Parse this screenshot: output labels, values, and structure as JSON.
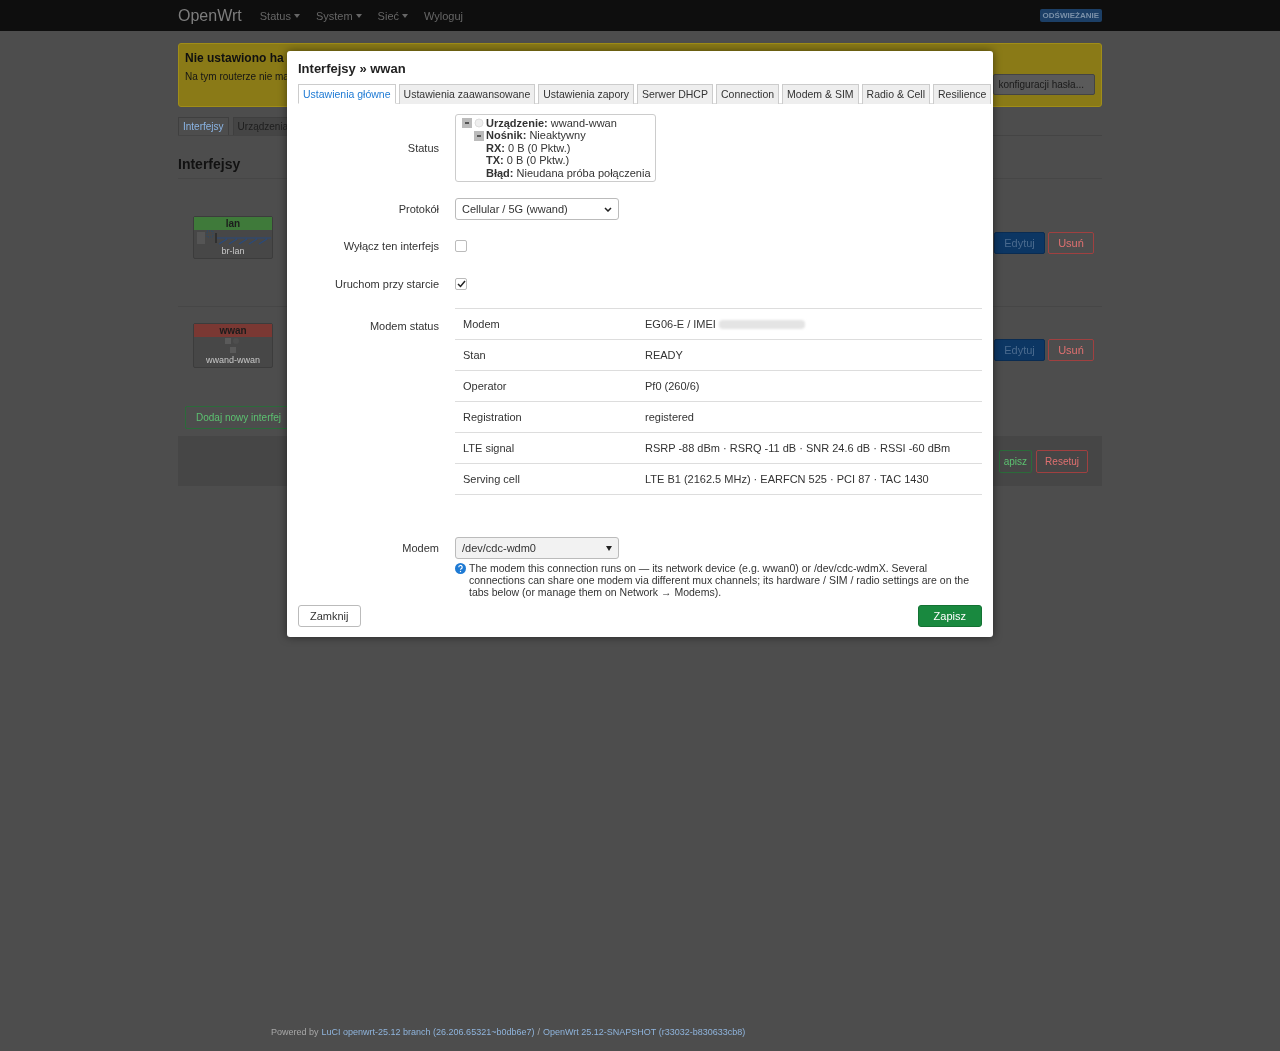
{
  "navbar": {
    "brand": "OpenWrt",
    "menu": [
      {
        "label": "Status",
        "has_caret": true
      },
      {
        "label": "System",
        "has_caret": true
      },
      {
        "label": "Sieć",
        "has_caret": true
      },
      {
        "label": "Wyloguj",
        "has_caret": false
      }
    ],
    "badge": "ODŚWIEŻANIE"
  },
  "warning": {
    "title": "Nie ustawiono ha",
    "text": "Na tym routerze nie ma",
    "button": "konfiguracji hasła..."
  },
  "page_tabs": [
    {
      "label": "Interfejsy",
      "selected": true
    },
    {
      "label": "Urządzenia",
      "selected": false
    }
  ],
  "heading": "Interfejsy",
  "interfaces": [
    {
      "name": "lan",
      "color": "#3f7a3a",
      "device": "br-lan",
      "kind": "bridge",
      "edit": "Edytuj",
      "delete": "Usuń"
    },
    {
      "name": "wwan",
      "color": "#7a3833",
      "device": "wwand-wwan",
      "kind": "modem",
      "edit": "Edytuj",
      "delete": "Usuń"
    }
  ],
  "add_button": "Dodaj nowy interfej",
  "actions": [
    {
      "label": "apisz",
      "kind": "save"
    },
    {
      "label": "Resetuj",
      "kind": "reset"
    }
  ],
  "footer": {
    "prefix": "Powered by",
    "luci": "LuCI openwrt-25.12 branch (26.206.65321~b0db6e7)",
    "separator": "/",
    "openwrt": "OpenWrt 25.12-SNAPSHOT (r33032-b830633cb8)"
  },
  "modal": {
    "title": "Interfejsy » wwan",
    "tabs": [
      {
        "label": "Ustawienia główne",
        "selected": true
      },
      {
        "label": "Ustawienia zaawansowane",
        "selected": false
      },
      {
        "label": "Ustawienia zapory",
        "selected": false
      },
      {
        "label": "Serwer DHCP",
        "selected": false
      },
      {
        "label": "Connection",
        "selected": false
      },
      {
        "label": "Modem & SIM",
        "selected": false
      },
      {
        "label": "Radio & Cell",
        "selected": false
      },
      {
        "label": "Resilience",
        "selected": false
      }
    ],
    "status": {
      "label": "Status",
      "lines": [
        {
          "key": "Urządzenie:",
          "value": "wwand-wwan"
        },
        {
          "key": "Nośnik:",
          "value": "Nieaktywny"
        },
        {
          "key": "RX:",
          "value": "0 B (0 Pktw.)"
        },
        {
          "key": "TX:",
          "value": "0 B (0 Pktw.)"
        },
        {
          "key": "Błąd:",
          "value": "Nieudana próba połączenia"
        }
      ]
    },
    "protocol": {
      "label": "Protokół",
      "value": "Cellular / 5G (wwand)"
    },
    "disable": {
      "label": "Wyłącz ten interfejs",
      "checked": false
    },
    "autostart": {
      "label": "Uruchom przy starcie",
      "checked": true
    },
    "modem_status": {
      "label": "Modem status",
      "rows": [
        {
          "name": "Modem",
          "value": "EG06-E / IMEI",
          "redacted": true
        },
        {
          "name": "Stan",
          "value": "READY",
          "redacted": false
        },
        {
          "name": "Operator",
          "value": "Pf0 (260/6)",
          "redacted": false
        },
        {
          "name": "Registration",
          "value": "registered",
          "redacted": false
        },
        {
          "name": "LTE signal",
          "value": "RSRP -88 dBm · RSRQ -11 dB · SNR 24.6 dB · RSSI -60 dBm",
          "redacted": false
        },
        {
          "name": "Serving cell",
          "value": "LTE B1 (2162.5 MHz) · EARFCN 525 · PCI 87 · TAC 1430",
          "redacted": false
        }
      ]
    },
    "modem": {
      "label": "Modem",
      "value": "/dev/cdc-wdm0",
      "help": "The modem this connection runs on — its network device (e.g. wwan0) or /dev/cdc-wdmX. Several connections can share one modem via different mux channels; its hardware / SIM / radio settings are on the tabs below (or manage them on Network → Modems)."
    },
    "close": "Zamknij",
    "save": "Zapisz"
  }
}
